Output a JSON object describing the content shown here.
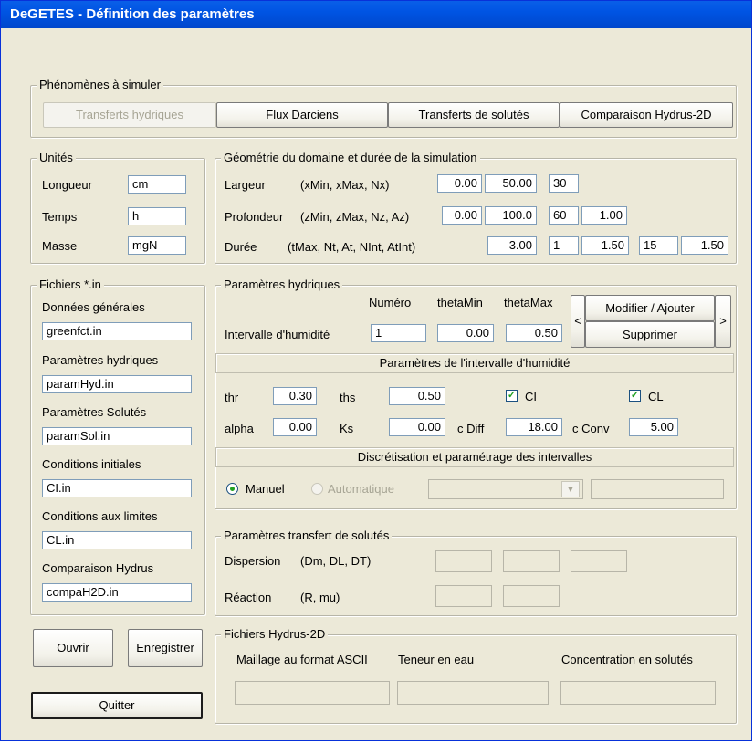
{
  "window": {
    "title": "DeGETES - Définition des paramètres"
  },
  "phenomenes": {
    "legend": "Phénomènes à simuler",
    "buttons": [
      "Transferts hydriques",
      "Flux Darciens",
      "Transferts de solutés",
      "Comparaison Hydrus-2D"
    ]
  },
  "unites": {
    "legend": "Unités",
    "rows": [
      {
        "label": "Longueur",
        "value": "cm"
      },
      {
        "label": "Temps",
        "value": "h"
      },
      {
        "label": "Masse",
        "value": "mgN"
      }
    ]
  },
  "geometrie": {
    "legend": "Géométrie du domaine et durée de la simulation",
    "largeur": {
      "label": "Largeur",
      "params": "(xMin, xMax, Nx)",
      "values": [
        "0.00",
        "50.00",
        "30"
      ]
    },
    "profondeur": {
      "label": "Profondeur",
      "params": "(zMin, zMax, Nz, Az)",
      "values": [
        "0.00",
        "100.0",
        "60",
        "1.00"
      ]
    },
    "duree": {
      "label": "Durée",
      "params": "(tMax, Nt, At, NInt, AtInt)",
      "values": [
        "3.00",
        "1",
        "1.50",
        "15",
        "1.50"
      ]
    }
  },
  "fichiers": {
    "legend": "Fichiers *.in",
    "items": [
      {
        "label": "Données générales",
        "value": "greenfct.in"
      },
      {
        "label": "Paramètres hydriques",
        "value": "paramHyd.in"
      },
      {
        "label": "Paramètres Solutés",
        "value": "paramSol.in"
      },
      {
        "label": "Conditions initiales",
        "value": "CI.in"
      },
      {
        "label": "Conditions aux limites",
        "value": "CL.in"
      },
      {
        "label": "Comparaison Hydrus",
        "value": "compaH2D.in"
      }
    ]
  },
  "hydriques": {
    "legend": "Paramètres hydriques",
    "col_numero": "Numéro",
    "col_thetamin": "thetaMin",
    "col_thetamax": "thetaMax",
    "intervalle_label": "Intervalle d'humidité",
    "numero": "1",
    "thetamin": "0.00",
    "thetamax": "0.50",
    "prev": "<",
    "next": ">",
    "modifier": "Modifier / Ajouter",
    "supprimer": "Supprimer",
    "band1": "Paramètres de l'intervalle d'humidité",
    "thr_label": "thr",
    "thr": "0.30",
    "ths_label": "ths",
    "ths": "0.50",
    "ci_label": "CI",
    "cl_label": "CL",
    "alpha_label": "alpha",
    "alpha": "0.00",
    "ks_label": "Ks",
    "ks": "0.00",
    "cdiff_label": "c Diff",
    "cdiff": "18.00",
    "cconv_label": "c Conv",
    "cconv": "5.00",
    "band2": "Discrétisation et paramétrage des intervalles",
    "manuel": "Manuel",
    "automatique": "Automatique"
  },
  "solutes": {
    "legend": "Paramètres transfert de solutés",
    "dispersion_label": "Dispersion",
    "dispersion_params": "(Dm, DL, DT)",
    "reaction_label": "Réaction",
    "reaction_params": "(R, mu)"
  },
  "hydrus": {
    "legend": "Fichiers Hydrus-2D",
    "maillage": "Maillage au format ASCII",
    "teneur": "Teneur en eau",
    "concentration": "Concentration en solutés"
  },
  "actions": {
    "ouvrir": "Ouvrir",
    "enregistrer": "Enregistrer",
    "quitter": "Quitter"
  },
  "colors": {
    "titlebar": "#0054e3",
    "face": "#ece9d8",
    "check": "#21a121"
  }
}
